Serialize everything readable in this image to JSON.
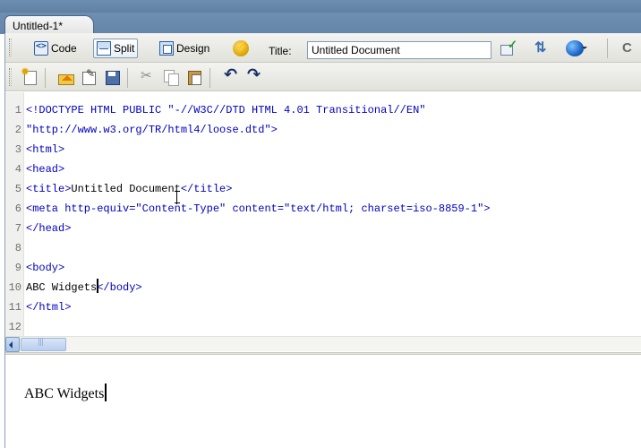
{
  "document": {
    "tab_label": "Untitled-1*"
  },
  "toolbar": {
    "code_label": "Code",
    "split_label": "Split",
    "design_label": "Design",
    "title_label": "Title:",
    "title_value": "Untitled Document",
    "active_view": "Split"
  },
  "icons": {
    "toolbar1": [
      "code-view-icon",
      "split-view-icon",
      "design-view-icon",
      "live-view-bolt-icon",
      "validate-icon",
      "file-transfer-icon",
      "preview-globe-icon",
      "refresh-icon"
    ],
    "toolbar2": [
      "new-document-icon",
      "open-icon",
      "edit-icon",
      "save-icon",
      "cut-icon",
      "copy-icon",
      "paste-icon",
      "undo-icon",
      "redo-icon"
    ]
  },
  "code": {
    "lines": [
      {
        "n": "1",
        "text": "<!DOCTYPE HTML PUBLIC \"-//W3C//DTD HTML 4.01 Transitional//EN\""
      },
      {
        "n": "2",
        "text": "\"http://www.w3.org/TR/html4/loose.dtd\">"
      },
      {
        "n": "3",
        "text": "<html>"
      },
      {
        "n": "4",
        "text": "<head>"
      },
      {
        "n": "5",
        "text": "<title>Untitled Document</title>"
      },
      {
        "n": "6",
        "text": "<meta http-equiv=\"Content-Type\" content=\"text/html; charset=iso-8859-1\">"
      },
      {
        "n": "7",
        "text": "</head>"
      },
      {
        "n": "8",
        "text": ""
      },
      {
        "n": "9",
        "text": "<body>"
      },
      {
        "n": "10",
        "text": "ABC Widgets</body>"
      },
      {
        "n": "11",
        "text": "</html>"
      },
      {
        "n": "12",
        "text": ""
      }
    ],
    "line10_text": "ABC Widgets",
    "line10_tag": "</body>",
    "line5_open": "<title>",
    "line5_text": "Untitled Document",
    "line5_close": "</title>"
  },
  "design": {
    "body_text": "ABC Widgets"
  },
  "colors": {
    "tag": "#0000c0",
    "text": "#000000",
    "chrome_blue": "#6f8fb2",
    "toolbar": "#ecece6"
  }
}
